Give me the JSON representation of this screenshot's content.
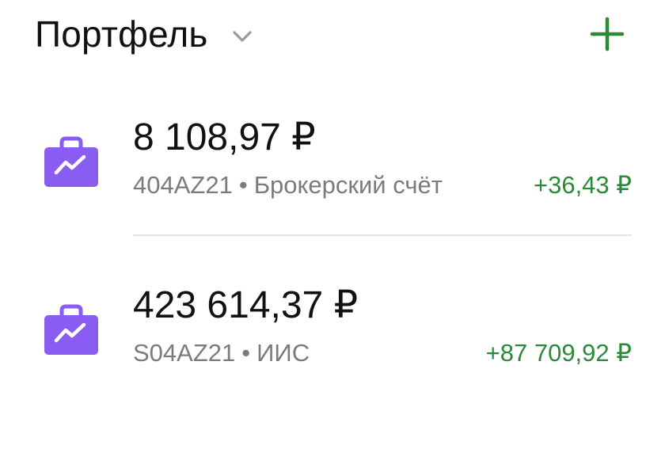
{
  "header": {
    "title": "Портфель",
    "chevron_icon": "chevron-down-icon",
    "add_icon": "plus-icon"
  },
  "accounts": [
    {
      "balance": "8 108,97 ₽",
      "account_id": "404AZ21",
      "separator": "•",
      "account_type": "Брокерский счёт",
      "change": "+36,43 ₽",
      "icon": "briefcase-chart-icon"
    },
    {
      "balance": "423 614,37 ₽",
      "account_id": "S04AZ21",
      "separator": "•",
      "account_type": "ИИС",
      "change": "+87 709,92 ₽",
      "icon": "briefcase-chart-icon"
    }
  ],
  "colors": {
    "accent_green": "#2a8a38",
    "icon_purple": "#8a5cf2",
    "secondary_text": "#7b7b7b"
  }
}
